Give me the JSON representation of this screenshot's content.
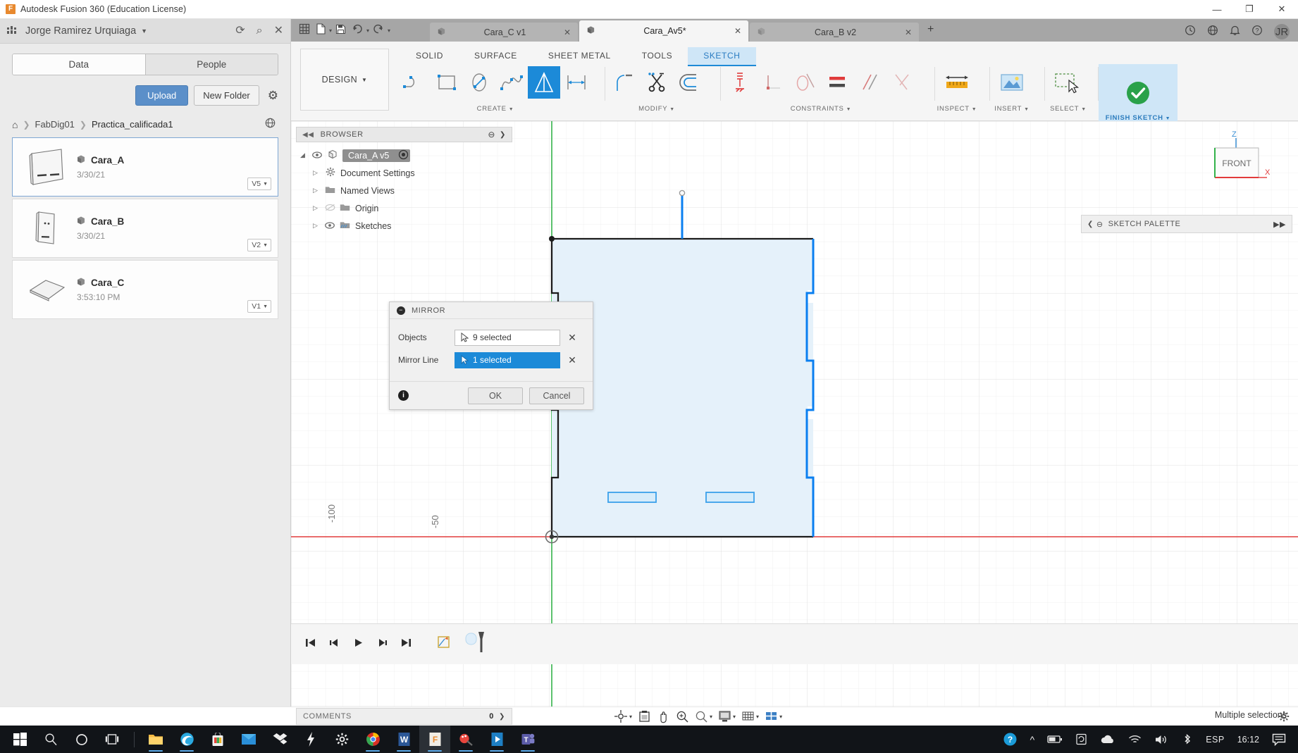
{
  "window": {
    "title": "Autodesk Fusion 360 (Education License)",
    "logo_letter": "F",
    "minimize": "—",
    "restore": "❐",
    "close": "✕"
  },
  "data_panel": {
    "user_name": "Jorge Ramirez Urquiaga",
    "caret": "▼",
    "grid_icon": "grid-icon",
    "refresh_icon": "⟳",
    "search_icon": "⌕",
    "close_icon": "✕",
    "tabs": [
      {
        "label": "Data",
        "active": true
      },
      {
        "label": "People",
        "active": false
      }
    ],
    "upload_label": "Upload",
    "new_folder_label": "New Folder",
    "settings_icon": "⚙",
    "breadcrumb": {
      "home_icon": "⌂",
      "separator": "❯",
      "items": [
        "FabDig01",
        "Practica_calificada1"
      ],
      "globe_icon": "⊕"
    },
    "files": [
      {
        "name": "Cara_A",
        "date": "3/30/21",
        "version": "V5",
        "selected": true
      },
      {
        "name": "Cara_B",
        "date": "3/30/21",
        "version": "V2",
        "selected": false
      },
      {
        "name": "Cara_C",
        "date": "3:53:10 PM",
        "version": "V1",
        "selected": false
      }
    ],
    "version_caret": "▼"
  },
  "doc_tabs": {
    "quick_access": [
      "grid-icon",
      "new-file-icon",
      "save-icon",
      "undo-icon",
      "redo-icon"
    ],
    "tabs": [
      {
        "label": "Cara_C v1",
        "active": false,
        "close": "✕"
      },
      {
        "label": "Cara_Av5*",
        "active": true,
        "close": "✕"
      },
      {
        "label": "Cara_B v2",
        "active": false,
        "close": "✕"
      }
    ],
    "add_tab": "+",
    "right_icons": [
      "history-icon",
      "help-globe-icon",
      "notification-bell-icon",
      "help-icon"
    ],
    "avatar_initials": "JR"
  },
  "ribbon": {
    "design_label": "DESIGN",
    "design_caret": "▼",
    "workspace_tabs": [
      {
        "label": "SOLID",
        "active": false
      },
      {
        "label": "SURFACE",
        "active": false
      },
      {
        "label": "SHEET METAL",
        "active": false
      },
      {
        "label": "TOOLS",
        "active": false
      },
      {
        "label": "SKETCH",
        "active": true
      }
    ],
    "groups": [
      {
        "label": "CREATE",
        "caret": "▼",
        "tools": [
          {
            "name": "line-tool-icon",
            "active": false
          },
          {
            "name": "rectangle-tool-icon",
            "active": false
          },
          {
            "name": "circle-tool-icon",
            "active": false
          },
          {
            "name": "spline-tool-icon",
            "active": false
          },
          {
            "name": "mirror-tool-icon",
            "active": true
          },
          {
            "name": "dimension-tool-icon",
            "active": false
          }
        ]
      },
      {
        "label": "MODIFY",
        "caret": "▼",
        "tools": [
          {
            "name": "fillet-tool-icon",
            "active": false
          },
          {
            "name": "trim-tool-icon",
            "active": false
          },
          {
            "name": "offset-tool-icon",
            "active": false
          }
        ]
      },
      {
        "label": "CONSTRAINTS",
        "caret": "▼",
        "tools": [
          {
            "name": "fix-unfix-icon",
            "active": false
          },
          {
            "name": "perpendicular-constraint-icon",
            "active": false
          },
          {
            "name": "tangent-constraint-icon",
            "active": false
          },
          {
            "name": "equal-constraint-icon",
            "active": false
          },
          {
            "name": "parallel-constraint-icon",
            "active": false
          },
          {
            "name": "symmetry-constraint-icon",
            "active": false
          }
        ]
      },
      {
        "label": "INSPECT",
        "caret": "▼",
        "tools": [
          {
            "name": "measure-icon",
            "active": false
          }
        ]
      },
      {
        "label": "INSERT",
        "caret": "▼",
        "tools": [
          {
            "name": "insert-image-icon",
            "active": false
          }
        ]
      },
      {
        "label": "SELECT",
        "caret": "▼",
        "tools": [
          {
            "name": "select-cursor-icon",
            "active": false
          }
        ]
      }
    ],
    "finish_sketch": {
      "label": "FINISH SKETCH",
      "caret": "▼",
      "icon": "checkmark-icon"
    }
  },
  "browser": {
    "title": "BROWSER",
    "collapse_icon": "◀◀",
    "dot_icon": "⊖",
    "arrow_icon": "❯",
    "nodes": [
      {
        "label": "Cara_A v5",
        "indent": 0,
        "expanded": true,
        "eye": true,
        "icon": "component-icon",
        "selected": true,
        "has_target": true
      },
      {
        "label": "Document Settings",
        "indent": 1,
        "expanded": false,
        "eye": false,
        "icon": "gear-icon",
        "selected": false
      },
      {
        "label": "Named Views",
        "indent": 1,
        "expanded": false,
        "eye": false,
        "icon": "folder-icon",
        "selected": false
      },
      {
        "label": "Origin",
        "indent": 1,
        "expanded": false,
        "eye": true,
        "eye_off": true,
        "icon": "folder-icon",
        "selected": false
      },
      {
        "label": "Sketches",
        "indent": 1,
        "expanded": false,
        "eye": true,
        "icon": "sketches-icon",
        "selected": false
      }
    ]
  },
  "sketch_palette": {
    "title": "SKETCH PALETTE",
    "left_icon": "❮",
    "minus_icon": "⊖",
    "expand_icon": "▶▶"
  },
  "viewcube": {
    "face_label": "FRONT",
    "axis_z": "Z",
    "axis_x": "X"
  },
  "mirror_dialog": {
    "title": "MIRROR",
    "minus": "−",
    "rows": [
      {
        "label": "Objects",
        "value": "9 selected",
        "active": false,
        "clear": "✕"
      },
      {
        "label": "Mirror Line",
        "value": "1 selected",
        "active": true,
        "clear": "✕"
      }
    ],
    "info_icon": "i",
    "ok_label": "OK",
    "cancel_label": "Cancel"
  },
  "status": {
    "comments_label": "COMMENTS",
    "comments_count": "0",
    "comments_arrow": "❯",
    "selection_text": "Multiple selections",
    "nav_tools": [
      "orbit-icon",
      "look-at-icon",
      "pan-icon",
      "zoom-icon",
      "zoom-window-icon",
      "display-settings-icon",
      "grid-snap-icon",
      "viewports-icon"
    ]
  },
  "timeline": {
    "buttons": [
      "skip-to-start-icon",
      "step-back-icon",
      "play-icon",
      "step-forward-icon",
      "skip-to-end-icon"
    ],
    "sketch_marker": "sketch-timeline-marker-icon",
    "playhead": "timeline-playhead-icon"
  },
  "viewport_axes": {
    "label_neg100": "-100",
    "label_neg50": "-50"
  },
  "taskbar": {
    "start": "start-icon",
    "apps": [
      "search-icon",
      "cortana-icon",
      "task-view-icon",
      "file-explorer-icon",
      "edge-icon",
      "store-icon",
      "mail-icon",
      "dropbox-icon",
      "lightning-icon",
      "settings-gear-icon",
      "chrome-icon",
      "word-icon",
      "fusion360-icon",
      "paint-icon",
      "movies-icon",
      "teams-icon"
    ],
    "tray": {
      "help": "help-icon",
      "chevron": "^",
      "battery": "battery-icon",
      "onedrive_sync": "sync-icon",
      "cloud": "cloud-icon",
      "wifi": "wifi-icon",
      "volume": "volume-icon",
      "bluetooth": "bluetooth-icon",
      "language": "ESP",
      "clock": "16:12",
      "action_center": "action-center-icon"
    }
  },
  "colors": {
    "accent_blue": "#1c8ad8",
    "selection_blue": "#0a7ff0",
    "sketch_fill": "#e8f3fb",
    "ribbon_bg": "#f5f5f5",
    "panel_bg": "#ebebeb",
    "taskbar_bg": "#111418"
  }
}
